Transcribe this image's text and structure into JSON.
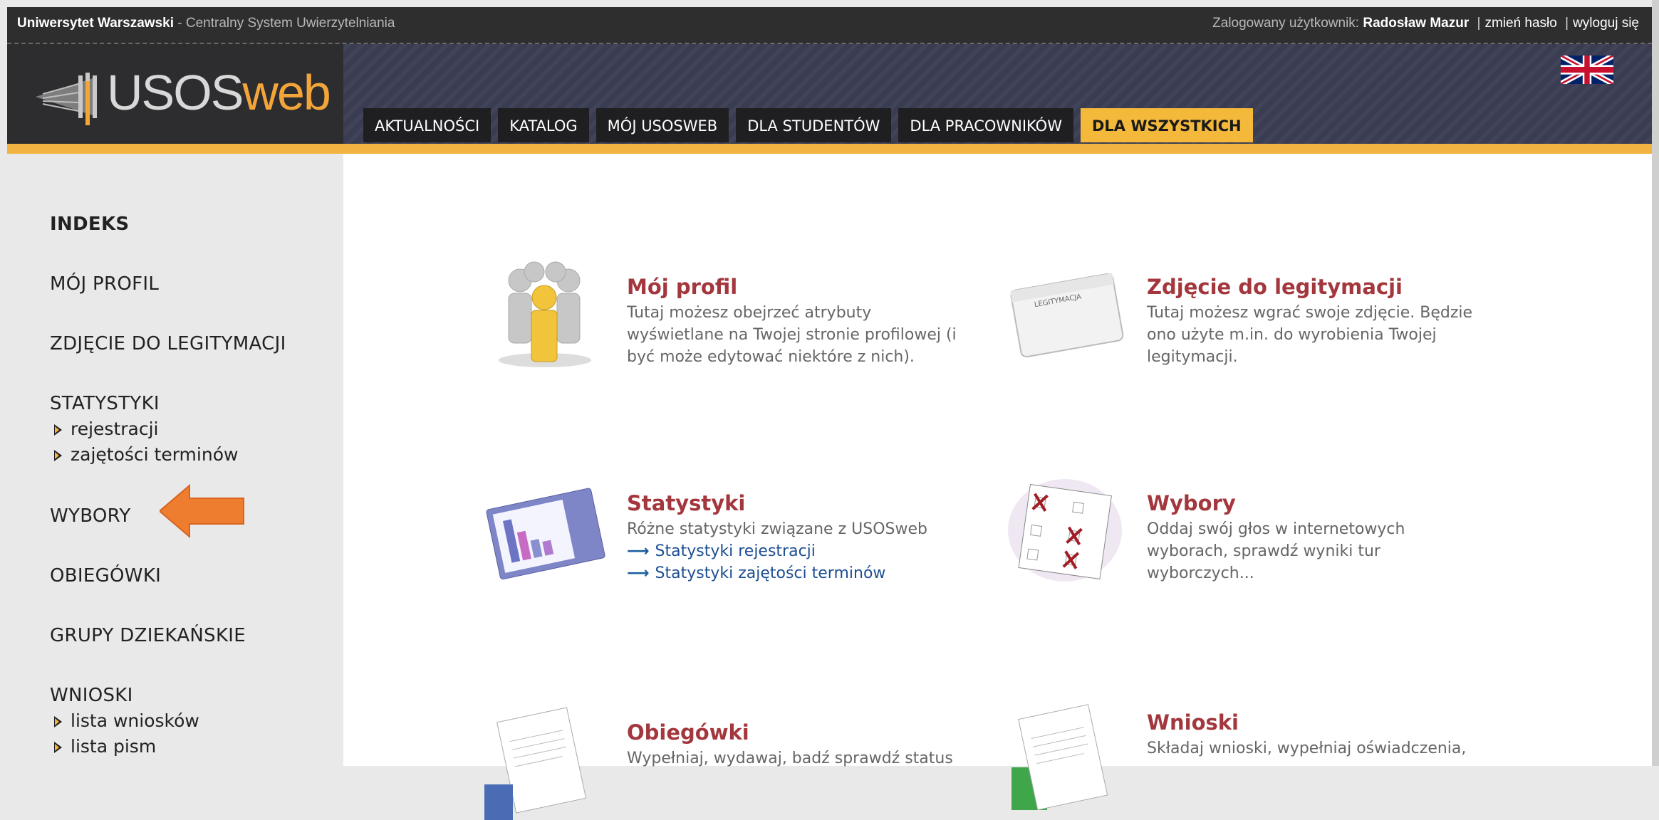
{
  "topbar": {
    "university": "Uniwersytet Warszawski",
    "system": " - Centralny System Uwierzytelniania",
    "logged_label": "Zalogowany użytkownik: ",
    "user_name": "Radosław Mazur",
    "change_password": "zmień hasło",
    "logout": "wyloguj się",
    "separator": "|"
  },
  "logo": {
    "part1": "USOS",
    "part2": "web"
  },
  "tabs": [
    {
      "label": "AKTUALNOŚCI",
      "active": false
    },
    {
      "label": "KATALOG",
      "active": false
    },
    {
      "label": "MÓJ USOSWEB",
      "active": false
    },
    {
      "label": "DLA STUDENTÓW",
      "active": false
    },
    {
      "label": "DLA PRACOWNIKÓW",
      "active": false
    },
    {
      "label": "DLA WSZYSTKICH",
      "active": true
    }
  ],
  "language_flag": "uk-flag-icon",
  "sidebar": {
    "items": [
      {
        "label": "INDEKS"
      },
      {
        "label": "MÓJ PROFIL"
      },
      {
        "label": "ZDJĘCIE DO LEGITYMACJI"
      },
      {
        "label": "STATYSTYKI"
      },
      {
        "label": "rejestracji"
      },
      {
        "label": "zajętości terminów"
      },
      {
        "label": "WYBORY"
      },
      {
        "label": "OBIEGÓWKI"
      },
      {
        "label": "GRUPY DZIEKAŃSKIE"
      },
      {
        "label": "WNIOSKI"
      },
      {
        "label": "lista wniosków"
      },
      {
        "label": "lista pism"
      }
    ]
  },
  "cards": [
    {
      "title": "Mój profil",
      "desc": "Tutaj możesz obejrzeć atrybuty wyświetlane na Twojej stronie profilowej (i być może edytować niektóre z nich).",
      "icon": "profile-group-icon"
    },
    {
      "title": "Zdjęcie do legitymacji",
      "desc": "Tutaj możesz wgrać swoje zdjęcie. Będzie ono użyte m.in. do wyrobienia Twojej legitymacji.",
      "icon": "id-card-icon",
      "card_text": "LEGITYMACJA"
    },
    {
      "title": "Statystyki",
      "desc": "Różne statystyki związane z USOSweb",
      "links": [
        "Statystyki rejestracji",
        "Statystyki zajętości terminów"
      ],
      "icon": "statistics-chart-icon"
    },
    {
      "title": "Wybory",
      "desc": "Oddaj swój głos w internetowych wyborach, sprawdź wyniki tur wyborczych...",
      "icon": "ballot-icon"
    },
    {
      "title": "Obiegówki",
      "desc": "Wypełniaj, wydawaj, badź sprawdź status",
      "icon": "documents-icon"
    },
    {
      "title": "Wnioski",
      "desc": "Składaj wnioski, wypełniaj oświadczenia,",
      "icon": "applications-icon"
    }
  ],
  "colors": {
    "accent": "#f2b441",
    "title_red": "#a3373d",
    "link_blue": "#1d4f93",
    "arrow": "#ef7d30"
  }
}
